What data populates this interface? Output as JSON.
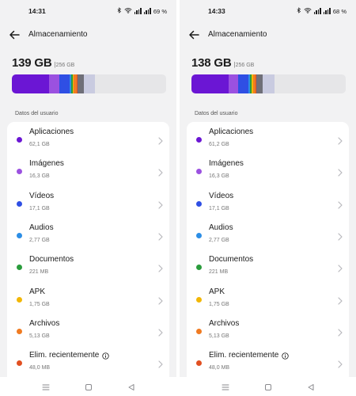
{
  "colors": {
    "apps": "#6b16d4",
    "images": "#9b51e0",
    "videos": "#2f4fe4",
    "audios": "#2c8ee6",
    "docs": "#2a9c3c",
    "apk": "#f2b705",
    "files": "#f07b22",
    "recent": "#e15021",
    "system": "#6f6f78",
    "other": "#c9cbe0"
  },
  "screens": [
    {
      "status": {
        "time": "14:31",
        "battery": "69 %"
      },
      "header": {
        "title": "Almacenamiento",
        "back_icon": "arrow-left-icon"
      },
      "storage": {
        "used": "139 GB",
        "separator": "|",
        "total": "256 GB"
      },
      "usage_bar": [
        {
          "key": "apps",
          "fraction": 0.242,
          "color": "#6b16d4"
        },
        {
          "key": "images",
          "fraction": 0.064,
          "color": "#9b51e0"
        },
        {
          "key": "videos",
          "fraction": 0.067,
          "color": "#2f4fe4"
        },
        {
          "key": "audios",
          "fraction": 0.011,
          "color": "#2c8ee6"
        },
        {
          "key": "docs",
          "fraction": 0.01,
          "color": "#2a9c3c"
        },
        {
          "key": "apk",
          "fraction": 0.007,
          "color": "#f2b705"
        },
        {
          "key": "files",
          "fraction": 0.02,
          "color": "#f07b22"
        },
        {
          "key": "recent",
          "fraction": 0.005,
          "color": "#e15021"
        },
        {
          "key": "system",
          "fraction": 0.04,
          "color": "#6f6f78"
        },
        {
          "key": "other",
          "fraction": 0.075,
          "color": "#c9cbe0"
        }
      ],
      "section_label": "Datos del usuario",
      "items": [
        {
          "name": "Aplicaciones",
          "size": "62,1 GB",
          "color": "#6b16d4"
        },
        {
          "name": "Imágenes",
          "size": "16,3 GB",
          "color": "#9b51e0"
        },
        {
          "name": "Vídeos",
          "size": "17,1 GB",
          "color": "#2f4fe4"
        },
        {
          "name": "Audios",
          "size": "2,77 GB",
          "color": "#2c8ee6"
        },
        {
          "name": "Documentos",
          "size": "221 MB",
          "color": "#2a9c3c"
        },
        {
          "name": "APK",
          "size": "1,75 GB",
          "color": "#f2b705"
        },
        {
          "name": "Archivos",
          "size": "5,13 GB",
          "color": "#f07b22"
        },
        {
          "name": "Elim. recientemente",
          "size": "48,0 MB",
          "color": "#e15021",
          "info": true
        }
      ]
    },
    {
      "status": {
        "time": "14:33",
        "battery": "68 %"
      },
      "header": {
        "title": "Almacenamiento",
        "back_icon": "arrow-left-icon"
      },
      "storage": {
        "used": "138 GB",
        "separator": "|",
        "total": "256 GB"
      },
      "usage_bar": [
        {
          "key": "apps",
          "fraction": 0.239,
          "color": "#6b16d4"
        },
        {
          "key": "images",
          "fraction": 0.064,
          "color": "#9b51e0"
        },
        {
          "key": "videos",
          "fraction": 0.067,
          "color": "#2f4fe4"
        },
        {
          "key": "audios",
          "fraction": 0.011,
          "color": "#2c8ee6"
        },
        {
          "key": "docs",
          "fraction": 0.01,
          "color": "#2a9c3c"
        },
        {
          "key": "apk",
          "fraction": 0.007,
          "color": "#f2b705"
        },
        {
          "key": "files",
          "fraction": 0.02,
          "color": "#f07b22"
        },
        {
          "key": "recent",
          "fraction": 0.005,
          "color": "#e15021"
        },
        {
          "key": "system",
          "fraction": 0.04,
          "color": "#6f6f78"
        },
        {
          "key": "other",
          "fraction": 0.075,
          "color": "#c9cbe0"
        }
      ],
      "section_label": "Datos del usuario",
      "items": [
        {
          "name": "Aplicaciones",
          "size": "61,2 GB",
          "color": "#6b16d4"
        },
        {
          "name": "Imágenes",
          "size": "16,3 GB",
          "color": "#9b51e0"
        },
        {
          "name": "Vídeos",
          "size": "17,1 GB",
          "color": "#2f4fe4"
        },
        {
          "name": "Audios",
          "size": "2,77 GB",
          "color": "#2c8ee6"
        },
        {
          "name": "Documentos",
          "size": "221 MB",
          "color": "#2a9c3c"
        },
        {
          "name": "APK",
          "size": "1,75 GB",
          "color": "#f2b705"
        },
        {
          "name": "Archivos",
          "size": "5,13 GB",
          "color": "#f07b22"
        },
        {
          "name": "Elim. recientemente",
          "size": "48,0 MB",
          "color": "#e15021",
          "info": true
        }
      ]
    }
  ],
  "navbar": {
    "icons": [
      "menu-icon",
      "home-icon",
      "back-triangle-icon"
    ]
  }
}
